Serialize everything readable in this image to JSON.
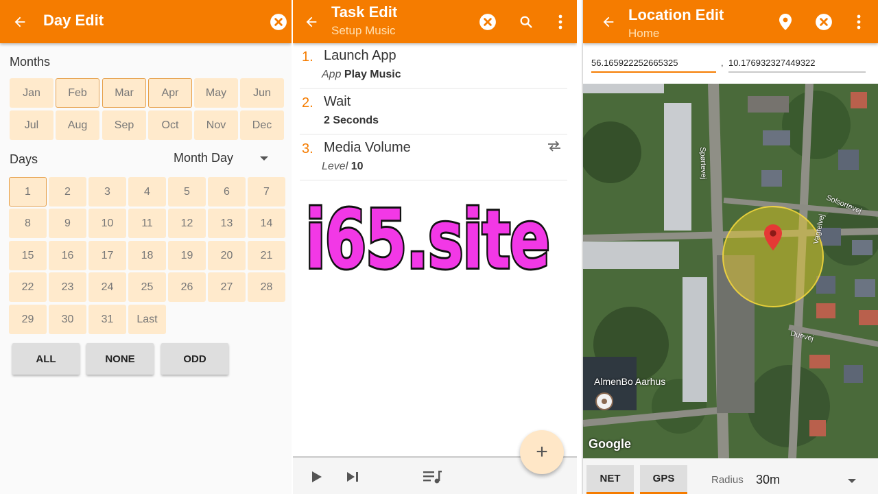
{
  "day_edit": {
    "title": "Day Edit",
    "months_label": "Months",
    "months": [
      {
        "label": "Jan",
        "selected": false
      },
      {
        "label": "Feb",
        "selected": true
      },
      {
        "label": "Mar",
        "selected": true
      },
      {
        "label": "Apr",
        "selected": true
      },
      {
        "label": "May",
        "selected": false
      },
      {
        "label": "Jun",
        "selected": false
      },
      {
        "label": "Jul",
        "selected": false
      },
      {
        "label": "Aug",
        "selected": false
      },
      {
        "label": "Sep",
        "selected": false
      },
      {
        "label": "Oct",
        "selected": false
      },
      {
        "label": "Nov",
        "selected": false
      },
      {
        "label": "Dec",
        "selected": false
      }
    ],
    "days_label": "Days",
    "day_mode": "Month Day",
    "days": [
      "1",
      "2",
      "3",
      "4",
      "5",
      "6",
      "7",
      "8",
      "9",
      "10",
      "11",
      "12",
      "13",
      "14",
      "15",
      "16",
      "17",
      "18",
      "19",
      "20",
      "21",
      "22",
      "23",
      "24",
      "25",
      "26",
      "27",
      "28",
      "29",
      "30",
      "31",
      "Last"
    ],
    "selected_days": [
      "1"
    ],
    "buttons": {
      "all": "ALL",
      "none": "NONE",
      "odd": "ODD"
    }
  },
  "task_edit": {
    "title": "Task Edit",
    "subtitle": "Setup Music",
    "actions": [
      {
        "num": "1.",
        "name": "Launch App",
        "param_label": "App",
        "param_value": "Play Music"
      },
      {
        "num": "2.",
        "name": "Wait",
        "param_label": "",
        "param_value": "2 Seconds"
      },
      {
        "num": "3.",
        "name": "Media Volume",
        "param_label": "Level",
        "param_value": "10"
      }
    ],
    "fab": "+"
  },
  "watermark": "i65.site",
  "location_edit": {
    "title": "Location Edit",
    "subtitle": "Home",
    "latitude": "56.165922252665325",
    "separator": ",",
    "longitude": "10.176932327449322",
    "map": {
      "place_label": "AlmenBo Aarhus",
      "streets": [
        "Spørtevej",
        "Solsortevej",
        "Vagtelvej",
        "Duevej"
      ],
      "attribution": "Google"
    },
    "net_label": "NET",
    "gps_label": "GPS",
    "radius_label": "Radius",
    "radius_value": "30m"
  },
  "colors": {
    "accent": "#f57c00",
    "chip": "#ffeacc",
    "selected_border": "#e6a04a"
  }
}
